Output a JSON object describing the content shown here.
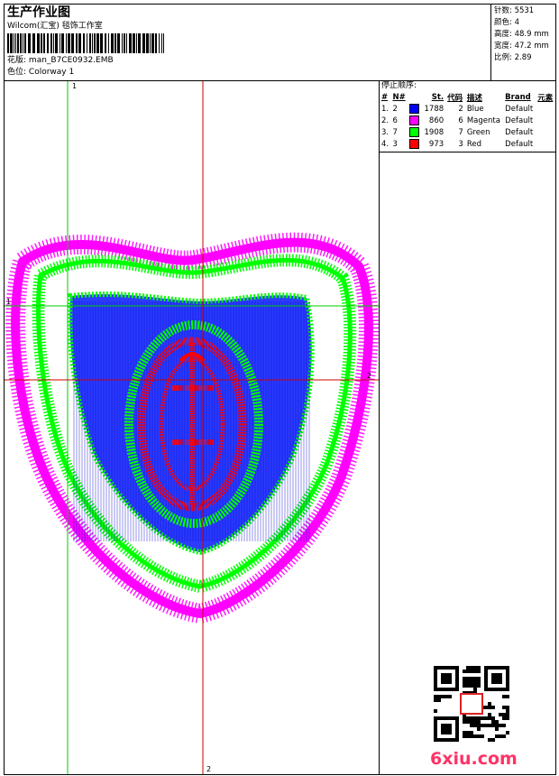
{
  "header": {
    "title": "生产作业图",
    "company": "Wilcom(汇宝) 毯饰工作室",
    "design_label": "花版:",
    "design_file": "man_B7CE0932.EMB",
    "colorway_label": "色位:",
    "colorway": "Colorway 1"
  },
  "stats": [
    {
      "label": "针数:",
      "value": "5531"
    },
    {
      "label": "颜色:",
      "value": "4"
    },
    {
      "label": "高度:",
      "value": "48.9 mm"
    },
    {
      "label": "宽度:",
      "value": "47.2 mm"
    },
    {
      "label": "比例:",
      "value": "2.89"
    }
  ],
  "stop_sequence": {
    "title": "停止顺序:",
    "headers": [
      "#",
      "N#",
      "St.",
      "代码",
      "描述",
      "Brand",
      "元素"
    ],
    "rows": [
      {
        "idx": "1.",
        "n": "2",
        "color": "#0000ff",
        "st": "1788",
        "code": "2",
        "desc": "Blue",
        "brand": "Default"
      },
      {
        "idx": "2.",
        "n": "6",
        "color": "#ff00ff",
        "st": "860",
        "code": "6",
        "desc": "Magenta",
        "brand": "Default"
      },
      {
        "idx": "3.",
        "n": "7",
        "color": "#00ff00",
        "st": "1908",
        "code": "7",
        "desc": "Green",
        "brand": "Default"
      },
      {
        "idx": "4.",
        "n": "3",
        "color": "#ff0000",
        "st": "973",
        "code": "3",
        "desc": "Red",
        "brand": "Default"
      }
    ]
  },
  "guides": {
    "v1": "1",
    "h1": "1",
    "v2": "2",
    "h2": "2"
  },
  "watermark": "6xiu.com",
  "colors": {
    "blue": "#0000ff",
    "magenta": "#ff00ff",
    "green": "#00ff00",
    "red": "#ff0000",
    "guide_green": "#00cc00",
    "guide_red": "#cc0000"
  }
}
